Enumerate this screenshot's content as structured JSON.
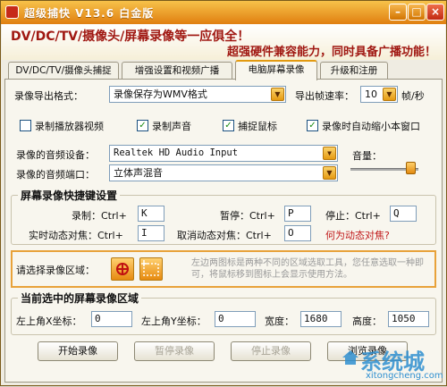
{
  "window": {
    "title": "超级捕快 V13.6 白金版",
    "min": "–",
    "max": "□",
    "close": "×"
  },
  "banner": {
    "line1": "DV/DC/TV/摄像头/屏幕录像等一应俱全！",
    "line2": "超强硬件兼容能力，同时具备广播功能！"
  },
  "tabs": [
    {
      "label": "DV/DC/TV/摄像头捕捉"
    },
    {
      "label": "增强设置和视频广播"
    },
    {
      "label": "电脑屏幕录像",
      "active": true
    },
    {
      "label": "升级和注册"
    }
  ],
  "export": {
    "label": "录像导出格式：",
    "value": "录像保存为WMV格式",
    "fps_label": "导出帧速率：",
    "fps_value": "10",
    "fps_unit": "帧/秒"
  },
  "checkboxes": [
    {
      "label": "录制播放器视频",
      "checked": false
    },
    {
      "label": "录制声音",
      "checked": true
    },
    {
      "label": "捕捉鼠标",
      "checked": true
    },
    {
      "label": "录像时自动缩小本窗口",
      "checked": true
    }
  ],
  "audio": {
    "device_label": "录像的音频设备：",
    "device_value": "Realtek HD Audio Input",
    "port_label": "录像的音频端口：",
    "port_value": "立体声混音",
    "volume_label": "音量：",
    "volume_level": 0.88
  },
  "hotkeys": {
    "title": "屏幕录像快捷键设置",
    "record_label": "录制：Ctrl+",
    "record_key": "K",
    "pause_label": "暂停：Ctrl+",
    "pause_key": "P",
    "stop_label": "停止：Ctrl+",
    "stop_key": "Q",
    "focus_label": "实时动态对焦：Ctrl+",
    "focus_key": "I",
    "cancel_focus_label": "取消动态对焦：Ctrl+",
    "cancel_focus_key": "O",
    "what_is_focus": "何为动态对焦?"
  },
  "region": {
    "label": "请选择录像区域：",
    "hint": "左边两图标是两种不同的区域选取工具，您任意选取一种即可，将鼠标移到图标上会显示使用方法。"
  },
  "current": {
    "title": "当前选中的屏幕录像区域",
    "x_label": "左上角X坐标：",
    "x_value": "0",
    "y_label": "左上角Y坐标：",
    "y_value": "0",
    "w_label": "宽度：",
    "w_value": "1680",
    "h_label": "高度：",
    "h_value": "1050"
  },
  "buttons": {
    "start": "开始录像",
    "pause": "暂停录像",
    "stop": "停止录像",
    "last": "浏览录像"
  },
  "watermark": {
    "text": "系统城",
    "url": "xitongcheng.com"
  },
  "colors": {
    "accent": "#e39a10",
    "title_red": "#a01812",
    "link": "#c0181a"
  }
}
